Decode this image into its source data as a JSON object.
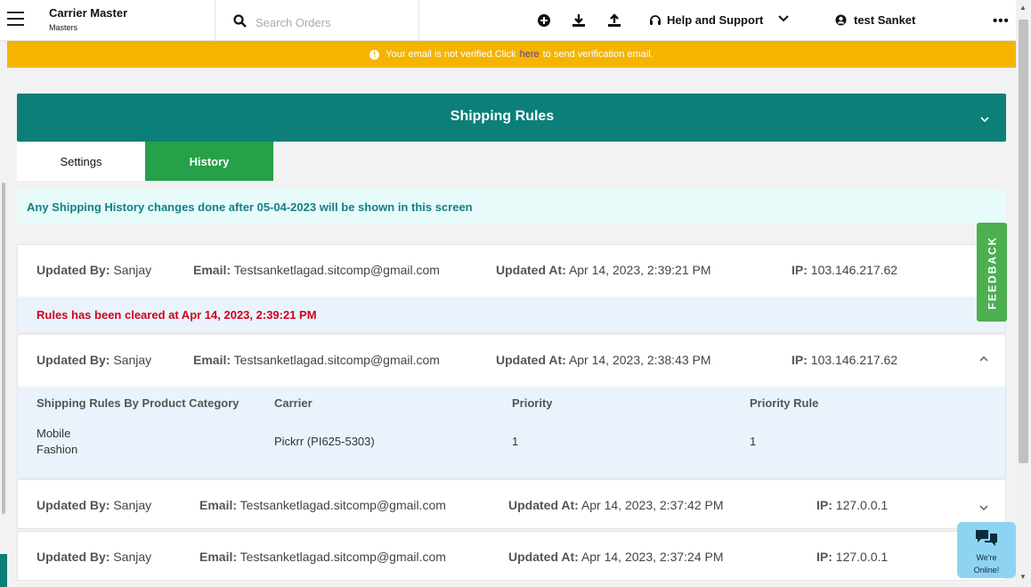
{
  "topbar": {
    "title": "Carrier Master",
    "subtitle": "Masters",
    "search_placeholder": "Search Orders",
    "help_label": "Help and Support",
    "user_name": "test Sanket"
  },
  "banner": {
    "text_before": "Your email is not verified.Click ",
    "link_text": "here",
    "text_after": " to send verification email."
  },
  "section": {
    "title": "Shipping Rules"
  },
  "tabs": [
    {
      "label": "Settings"
    },
    {
      "label": "History"
    }
  ],
  "info_text": "Any Shipping History changes done after 05-04-2023 will be shown in this screen",
  "labels": {
    "updated_by": "Updated By:",
    "email": "Email:",
    "updated_at": "Updated At:",
    "ip": "IP:"
  },
  "history": [
    {
      "updated_by": "Sanjay",
      "email": "Testsanketlagad.sitcomp@gmail.com",
      "updated_at": "Apr 14, 2023, 2:39:21 PM",
      "ip": "103.146.217.62",
      "message": "Rules has been cleared at Apr 14, 2023, 2:39:21 PM"
    },
    {
      "updated_by": "Sanjay",
      "email": "Testsanketlagad.sitcomp@gmail.com",
      "updated_at": "Apr 14, 2023, 2:38:43 PM",
      "ip": "103.146.217.62",
      "detail": {
        "headers": [
          "Shipping Rules By Product Category",
          "Carrier",
          "Priority",
          "Priority Rule"
        ],
        "categories": [
          "Mobile",
          "Fashion"
        ],
        "carrier": "Pickrr (PI625-5303)",
        "priority": "1",
        "priority_rule": "1"
      }
    },
    {
      "updated_by": "Sanjay",
      "email": "Testsanketlagad.sitcomp@gmail.com",
      "updated_at": "Apr 14, 2023, 2:37:42 PM",
      "ip": "127.0.0.1"
    },
    {
      "updated_by": "Sanjay",
      "email": "Testsanketlagad.sitcomp@gmail.com",
      "updated_at": "Apr 14, 2023, 2:37:24 PM",
      "ip": "127.0.0.1"
    }
  ],
  "feedback_label": "FEEDBACK",
  "chat": {
    "line1": "We're",
    "line2": "Online!"
  }
}
